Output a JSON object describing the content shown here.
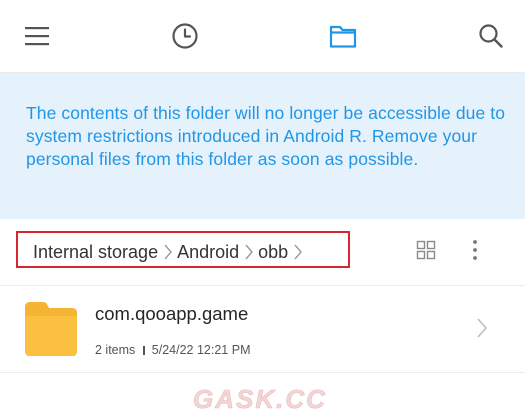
{
  "toolbar": {
    "icons": [
      "menu-icon",
      "clock-icon",
      "folder-icon",
      "search-icon"
    ],
    "active_color": "#2196e6",
    "inactive_color": "#555555"
  },
  "notice": {
    "text": "The contents of this folder will no longer be accessible due to system restrictions introduced in Android R. Remove your personal files from this folder as soon as possible.",
    "text_color": "#2196e6",
    "background": "#e5f2fc"
  },
  "breadcrumb": {
    "items": [
      "Internal storage",
      "Android",
      "obb"
    ],
    "highlight_color": "#d6262f"
  },
  "file_list": [
    {
      "name": "com.qooapp.game",
      "count": "2 items",
      "modified": "5/24/22 12:21 PM",
      "icon": "folder-icon"
    }
  ],
  "watermark": {
    "text": "GASK.CC"
  }
}
